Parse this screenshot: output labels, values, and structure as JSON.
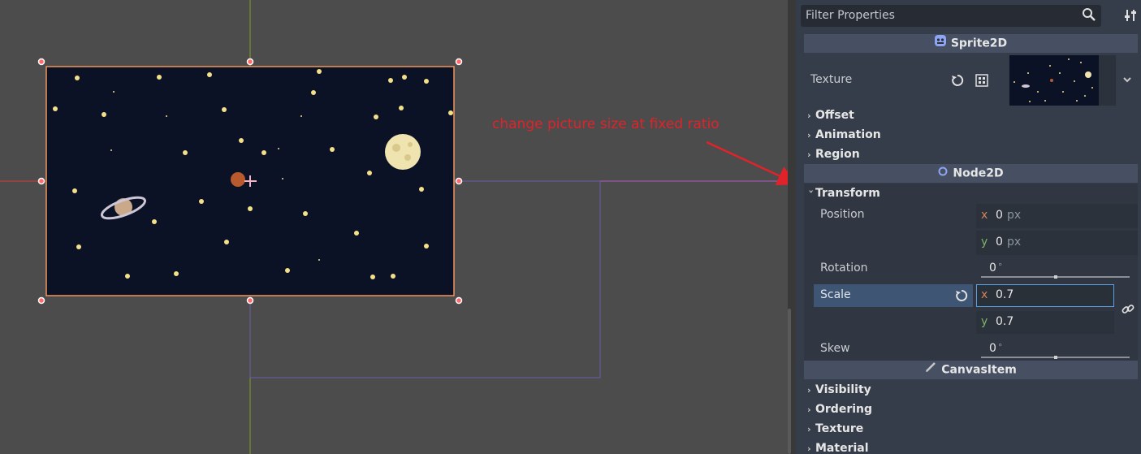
{
  "annotation": {
    "text": "change picture size at fixed ratio",
    "color": "#e0232a"
  },
  "filter": {
    "placeholder": "Filter Properties"
  },
  "sprite2d": {
    "header": "Sprite2D",
    "texture_label": "Texture",
    "groups": [
      "Offset",
      "Animation",
      "Region"
    ]
  },
  "node2d": {
    "header": "Node2D",
    "transform_label": "Transform",
    "position": {
      "label": "Position",
      "x": "0",
      "y": "0",
      "unit": "px",
      "x_axis": "x",
      "y_axis": "y"
    },
    "rotation": {
      "label": "Rotation",
      "value": "0",
      "unit": "°"
    },
    "scale": {
      "label": "Scale",
      "x": "0.7",
      "y": "0.7",
      "x_axis": "x",
      "y_axis": "y"
    },
    "skew": {
      "label": "Skew",
      "value": "0",
      "unit": "°"
    }
  },
  "canvas_item": {
    "header": "CanvasItem",
    "groups": [
      "Visibility",
      "Ordering",
      "Texture",
      "Material"
    ]
  },
  "colors": {
    "viewport_bg": "#4c4c4c",
    "inspector_bg": "#363d4a",
    "section_header": "#475062",
    "selection_border": "#f0955b",
    "axis_x": "#d4825b",
    "axis_y": "#7cb36a",
    "focus_border": "#5aa0e6"
  },
  "icons": [
    "search-icon",
    "inspector-tools-icon",
    "sprite2d-icon",
    "reload-icon",
    "checker-icon",
    "chevron-down-icon",
    "node2d-icon",
    "pencil-icon",
    "link-icon"
  ]
}
